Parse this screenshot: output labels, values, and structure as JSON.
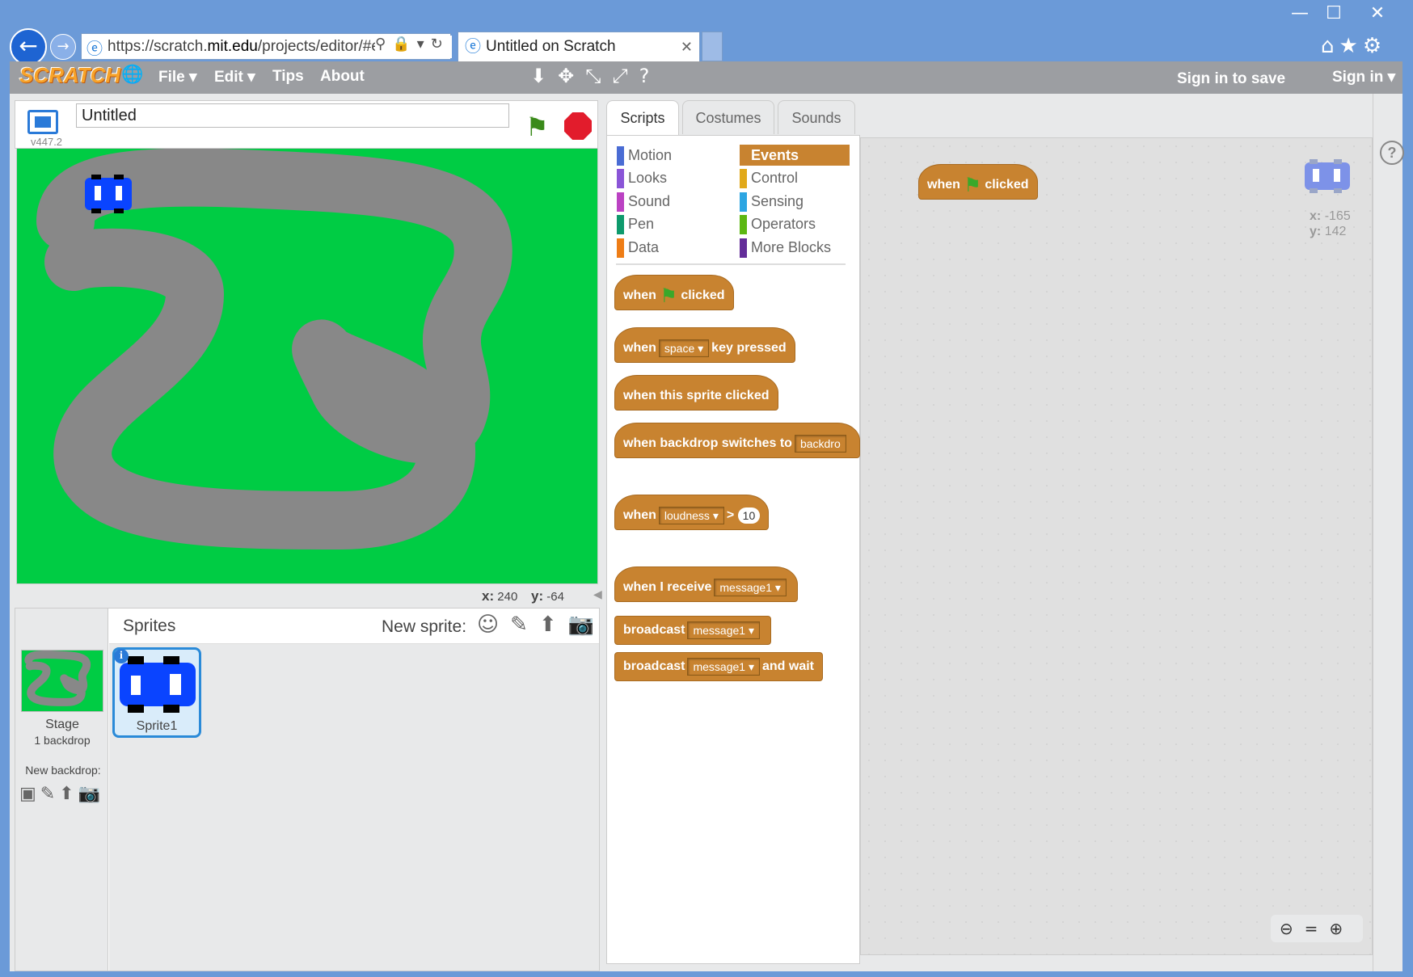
{
  "browser": {
    "url_prefix": "https://scratch.",
    "url_domain": "mit.edu",
    "url_suffix": "/projects/editor/#e",
    "tab_title": "Untitled on Scratch",
    "win_minimize": "—",
    "win_maximize": "☐",
    "win_close": "✕",
    "tab_close": "✕",
    "address_icons": "⚲🔒▾↻",
    "right_icons": "⌂★⚙"
  },
  "menubar": {
    "logo": "SCRATCH",
    "globe": "🌐",
    "file": "File ▾",
    "edit": "Edit ▾",
    "tips": "Tips",
    "about": "About",
    "tool_icons": "⬇✥⤡⤢?",
    "sign_in_save": "Sign in to save",
    "sign_in": "Sign in ▾"
  },
  "stage": {
    "project_title": "Untitled",
    "version": "v447.2",
    "mouse_x_label": "x:",
    "mouse_x": "240",
    "mouse_y_label": "y:",
    "mouse_y": "-64",
    "collapse_arrow": "◀"
  },
  "sprites": {
    "header": "Sprites",
    "new_sprite": "New sprite:",
    "new_sprite_icons": "☺✎⬆📷",
    "stage_label": "Stage",
    "stage_sub": "1 backdrop",
    "new_backdrop": "New backdrop:",
    "new_backdrop_icons": "▣✎⬆📷",
    "sprite1_label": "Sprite1",
    "info_icon": "i"
  },
  "tabs": [
    "Scripts",
    "Costumes",
    "Sounds"
  ],
  "categories": {
    "left": [
      {
        "label": "Motion",
        "color": "#4a6cd4"
      },
      {
        "label": "Looks",
        "color": "#8a55d7"
      },
      {
        "label": "Sound",
        "color": "#bb42c3"
      },
      {
        "label": "Pen",
        "color": "#0e9a6c"
      },
      {
        "label": "Data",
        "color": "#ee7d16"
      }
    ],
    "right": [
      {
        "label": "Events",
        "color": "#c88330"
      },
      {
        "label": "Control",
        "color": "#e1a91a"
      },
      {
        "label": "Sensing",
        "color": "#2ca5e2"
      },
      {
        "label": "Operators",
        "color": "#5cb712"
      },
      {
        "label": "More Blocks",
        "color": "#632d99"
      }
    ]
  },
  "blocks": {
    "b1_when": "when",
    "b1_clicked": "clicked",
    "b2_when": "when",
    "b2_key": "space",
    "b2_rest": "key pressed",
    "b3": "when this sprite clicked",
    "b4": "when backdrop switches to",
    "b4_dd": "backdro",
    "b5_when": "when",
    "b5_dd": "loudness",
    "b5_gt": ">",
    "b5_num": "10",
    "b6": "when I receive",
    "b6_dd": "message1",
    "b7": "broadcast",
    "b7_dd": "message1",
    "b8": "broadcast",
    "b8_dd": "message1",
    "b8_rest": "and wait",
    "dd_arrow": "▾",
    "flag_glyph": "⚑"
  },
  "script_area": {
    "hat_when": "when",
    "hat_clicked": "clicked",
    "x_label": "x:",
    "x_val": "-165",
    "y_label": "y:",
    "y_val": "142",
    "help": "?",
    "zoom_icons": "⊖=⊕"
  }
}
